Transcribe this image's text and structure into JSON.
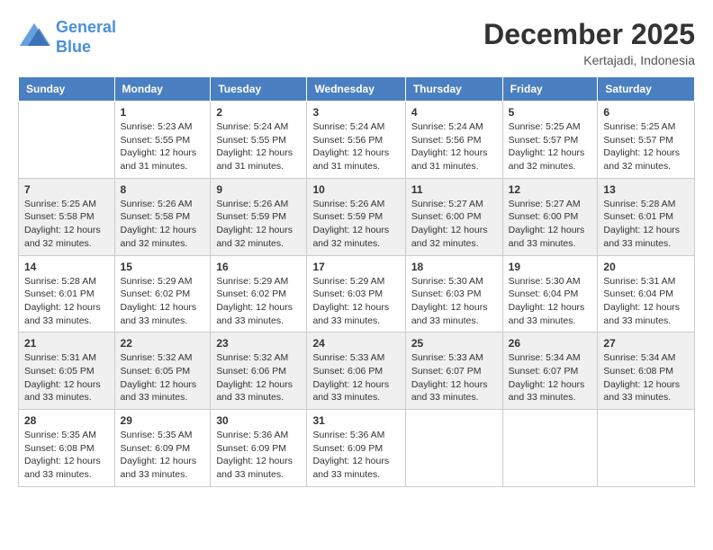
{
  "app": {
    "name": "GeneralBlue",
    "name_part1": "General",
    "name_part2": "Blue"
  },
  "header": {
    "month_year": "December 2025",
    "location": "Kertajadi, Indonesia"
  },
  "weekdays": [
    "Sunday",
    "Monday",
    "Tuesday",
    "Wednesday",
    "Thursday",
    "Friday",
    "Saturday"
  ],
  "weeks": [
    [
      {
        "day": "",
        "info": ""
      },
      {
        "day": "1",
        "info": "Sunrise: 5:23 AM\nSunset: 5:55 PM\nDaylight: 12 hours\nand 31 minutes."
      },
      {
        "day": "2",
        "info": "Sunrise: 5:24 AM\nSunset: 5:55 PM\nDaylight: 12 hours\nand 31 minutes."
      },
      {
        "day": "3",
        "info": "Sunrise: 5:24 AM\nSunset: 5:56 PM\nDaylight: 12 hours\nand 31 minutes."
      },
      {
        "day": "4",
        "info": "Sunrise: 5:24 AM\nSunset: 5:56 PM\nDaylight: 12 hours\nand 31 minutes."
      },
      {
        "day": "5",
        "info": "Sunrise: 5:25 AM\nSunset: 5:57 PM\nDaylight: 12 hours\nand 32 minutes."
      },
      {
        "day": "6",
        "info": "Sunrise: 5:25 AM\nSunset: 5:57 PM\nDaylight: 12 hours\nand 32 minutes."
      }
    ],
    [
      {
        "day": "7",
        "info": "Sunrise: 5:25 AM\nSunset: 5:58 PM\nDaylight: 12 hours\nand 32 minutes."
      },
      {
        "day": "8",
        "info": "Sunrise: 5:26 AM\nSunset: 5:58 PM\nDaylight: 12 hours\nand 32 minutes."
      },
      {
        "day": "9",
        "info": "Sunrise: 5:26 AM\nSunset: 5:59 PM\nDaylight: 12 hours\nand 32 minutes."
      },
      {
        "day": "10",
        "info": "Sunrise: 5:26 AM\nSunset: 5:59 PM\nDaylight: 12 hours\nand 32 minutes."
      },
      {
        "day": "11",
        "info": "Sunrise: 5:27 AM\nSunset: 6:00 PM\nDaylight: 12 hours\nand 32 minutes."
      },
      {
        "day": "12",
        "info": "Sunrise: 5:27 AM\nSunset: 6:00 PM\nDaylight: 12 hours\nand 33 minutes."
      },
      {
        "day": "13",
        "info": "Sunrise: 5:28 AM\nSunset: 6:01 PM\nDaylight: 12 hours\nand 33 minutes."
      }
    ],
    [
      {
        "day": "14",
        "info": "Sunrise: 5:28 AM\nSunset: 6:01 PM\nDaylight: 12 hours\nand 33 minutes."
      },
      {
        "day": "15",
        "info": "Sunrise: 5:29 AM\nSunset: 6:02 PM\nDaylight: 12 hours\nand 33 minutes."
      },
      {
        "day": "16",
        "info": "Sunrise: 5:29 AM\nSunset: 6:02 PM\nDaylight: 12 hours\nand 33 minutes."
      },
      {
        "day": "17",
        "info": "Sunrise: 5:29 AM\nSunset: 6:03 PM\nDaylight: 12 hours\nand 33 minutes."
      },
      {
        "day": "18",
        "info": "Sunrise: 5:30 AM\nSunset: 6:03 PM\nDaylight: 12 hours\nand 33 minutes."
      },
      {
        "day": "19",
        "info": "Sunrise: 5:30 AM\nSunset: 6:04 PM\nDaylight: 12 hours\nand 33 minutes."
      },
      {
        "day": "20",
        "info": "Sunrise: 5:31 AM\nSunset: 6:04 PM\nDaylight: 12 hours\nand 33 minutes."
      }
    ],
    [
      {
        "day": "21",
        "info": "Sunrise: 5:31 AM\nSunset: 6:05 PM\nDaylight: 12 hours\nand 33 minutes."
      },
      {
        "day": "22",
        "info": "Sunrise: 5:32 AM\nSunset: 6:05 PM\nDaylight: 12 hours\nand 33 minutes."
      },
      {
        "day": "23",
        "info": "Sunrise: 5:32 AM\nSunset: 6:06 PM\nDaylight: 12 hours\nand 33 minutes."
      },
      {
        "day": "24",
        "info": "Sunrise: 5:33 AM\nSunset: 6:06 PM\nDaylight: 12 hours\nand 33 minutes."
      },
      {
        "day": "25",
        "info": "Sunrise: 5:33 AM\nSunset: 6:07 PM\nDaylight: 12 hours\nand 33 minutes."
      },
      {
        "day": "26",
        "info": "Sunrise: 5:34 AM\nSunset: 6:07 PM\nDaylight: 12 hours\nand 33 minutes."
      },
      {
        "day": "27",
        "info": "Sunrise: 5:34 AM\nSunset: 6:08 PM\nDaylight: 12 hours\nand 33 minutes."
      }
    ],
    [
      {
        "day": "28",
        "info": "Sunrise: 5:35 AM\nSunset: 6:08 PM\nDaylight: 12 hours\nand 33 minutes."
      },
      {
        "day": "29",
        "info": "Sunrise: 5:35 AM\nSunset: 6:09 PM\nDaylight: 12 hours\nand 33 minutes."
      },
      {
        "day": "30",
        "info": "Sunrise: 5:36 AM\nSunset: 6:09 PM\nDaylight: 12 hours\nand 33 minutes."
      },
      {
        "day": "31",
        "info": "Sunrise: 5:36 AM\nSunset: 6:09 PM\nDaylight: 12 hours\nand 33 minutes."
      },
      {
        "day": "",
        "info": ""
      },
      {
        "day": "",
        "info": ""
      },
      {
        "day": "",
        "info": ""
      }
    ]
  ]
}
